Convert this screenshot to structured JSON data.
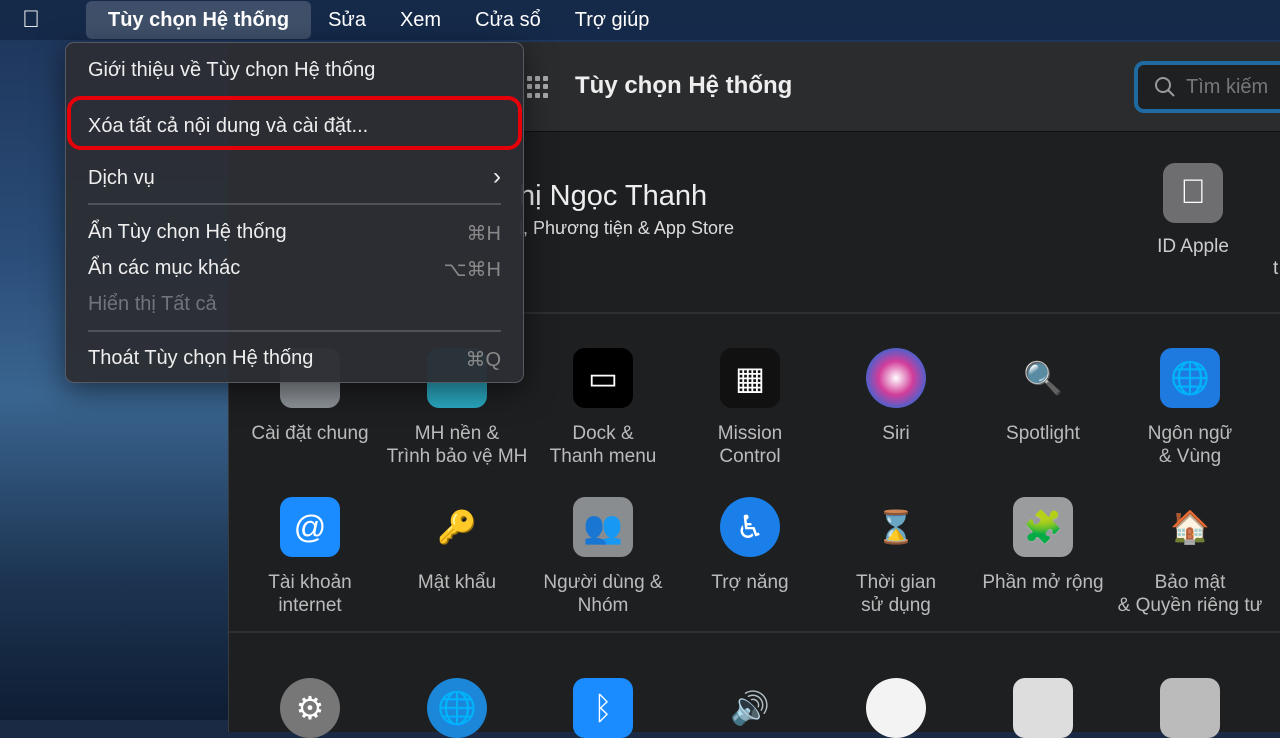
{
  "menubar": {
    "apple_icon": "apple-logo",
    "items": [
      "Tùy chọn Hệ thống",
      "Sửa",
      "Xem",
      "Cửa sổ",
      "Trợ giúp"
    ]
  },
  "app_menu": {
    "items": [
      {
        "label": "Giới thiệu về Tùy chọn Hệ thống",
        "shortcut": ""
      },
      {
        "label": "Xóa tất cả nội dung và cài đặt...",
        "shortcut": "",
        "highlighted": true
      },
      {
        "label": "Dịch vụ",
        "shortcut": "›"
      },
      {
        "label": "Ẩn Tùy chọn Hệ thống",
        "shortcut": "⌘H"
      },
      {
        "label": "Ẩn các mục khác",
        "shortcut": "⌥⌘H"
      },
      {
        "label": "Hiển thị Tất cả",
        "shortcut": "",
        "disabled": true
      },
      {
        "label": "Thoát Tùy chọn Hệ thống",
        "shortcut": "⌘Q"
      }
    ],
    "highlight_color": "#e6000a"
  },
  "window": {
    "title": "Tùy chọn Hệ thống",
    "search_placeholder": "Tìm kiếm",
    "user": {
      "name": "hị Ngọc Thanh",
      "subtitle": "l, Phương tiện & App Store"
    },
    "apple_id_label": "ID Apple",
    "edge_text": "t",
    "row1": [
      {
        "label": "Cài đặt chung",
        "icon": "general-icon"
      },
      {
        "label": "MH nền &\nTrình bảo vệ MH",
        "icon": "desktop-screensaver-icon"
      },
      {
        "label": "Dock &\nThanh menu",
        "icon": "dock-icon"
      },
      {
        "label": "Mission\nControl",
        "icon": "mission-control-icon"
      },
      {
        "label": "Siri",
        "icon": "siri-icon"
      },
      {
        "label": "Spotlight",
        "icon": "spotlight-icon"
      },
      {
        "label": "Ngôn ngữ\n& Vùng",
        "icon": "language-region-icon"
      }
    ],
    "row2": [
      {
        "label": "Tài khoản\ninternet",
        "icon": "internet-accounts-icon"
      },
      {
        "label": "Mật khẩu",
        "icon": "key-icon"
      },
      {
        "label": "Người dùng &\nNhóm",
        "icon": "users-groups-icon"
      },
      {
        "label": "Trợ năng",
        "icon": "accessibility-icon"
      },
      {
        "label": "Thời gian\nsử dụng",
        "icon": "screen-time-icon"
      },
      {
        "label": "Phần mở rộng",
        "icon": "extensions-icon"
      },
      {
        "label": "Bảo mật\n& Quyền riêng tư",
        "icon": "security-privacy-icon"
      }
    ],
    "row3_icons": [
      "software-update-icon",
      "network-icon",
      "bluetooth-icon",
      "sound-icon",
      "touch-id-icon",
      "keyboard-icon",
      "trackpad-icon"
    ]
  }
}
